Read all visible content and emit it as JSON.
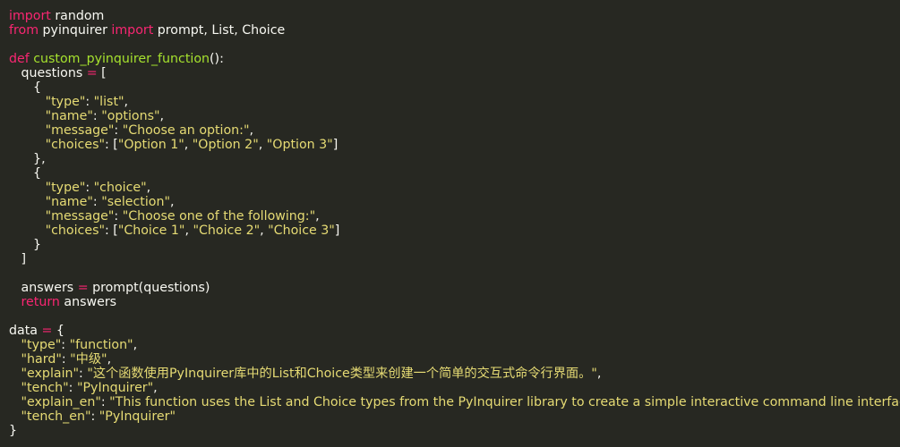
{
  "colors": {
    "background": "#272822",
    "default": "#f8f8f2",
    "keyword": "#f92672",
    "function": "#a6e22e",
    "string": "#e6db74"
  },
  "code": {
    "lines": [
      [
        {
          "t": "import",
          "c": "kw"
        },
        {
          "t": " random",
          "c": "pl"
        }
      ],
      [
        {
          "t": "from",
          "c": "kw"
        },
        {
          "t": " pyinquirer ",
          "c": "pl"
        },
        {
          "t": "import",
          "c": "kw"
        },
        {
          "t": " prompt, List, Choice",
          "c": "pl"
        }
      ],
      [],
      [
        {
          "t": "def",
          "c": "kw"
        },
        {
          "t": " ",
          "c": "pl"
        },
        {
          "t": "custom_pyinquirer_function",
          "c": "fn"
        },
        {
          "t": "():",
          "c": "pl"
        }
      ],
      [
        {
          "t": "   questions ",
          "c": "pl"
        },
        {
          "t": "=",
          "c": "op"
        },
        {
          "t": " [",
          "c": "pl"
        }
      ],
      [
        {
          "t": "      {",
          "c": "pl"
        }
      ],
      [
        {
          "t": "         ",
          "c": "pl"
        },
        {
          "t": "\"type\"",
          "c": "st"
        },
        {
          "t": ": ",
          "c": "pl"
        },
        {
          "t": "\"list\"",
          "c": "st"
        },
        {
          "t": ",",
          "c": "pl"
        }
      ],
      [
        {
          "t": "         ",
          "c": "pl"
        },
        {
          "t": "\"name\"",
          "c": "st"
        },
        {
          "t": ": ",
          "c": "pl"
        },
        {
          "t": "\"options\"",
          "c": "st"
        },
        {
          "t": ",",
          "c": "pl"
        }
      ],
      [
        {
          "t": "         ",
          "c": "pl"
        },
        {
          "t": "\"message\"",
          "c": "st"
        },
        {
          "t": ": ",
          "c": "pl"
        },
        {
          "t": "\"Choose an option:\"",
          "c": "st"
        },
        {
          "t": ",",
          "c": "pl"
        }
      ],
      [
        {
          "t": "         ",
          "c": "pl"
        },
        {
          "t": "\"choices\"",
          "c": "st"
        },
        {
          "t": ": [",
          "c": "pl"
        },
        {
          "t": "\"Option 1\"",
          "c": "st"
        },
        {
          "t": ", ",
          "c": "pl"
        },
        {
          "t": "\"Option 2\"",
          "c": "st"
        },
        {
          "t": ", ",
          "c": "pl"
        },
        {
          "t": "\"Option 3\"",
          "c": "st"
        },
        {
          "t": "]",
          "c": "pl"
        }
      ],
      [
        {
          "t": "      },",
          "c": "pl"
        }
      ],
      [
        {
          "t": "      {",
          "c": "pl"
        }
      ],
      [
        {
          "t": "         ",
          "c": "pl"
        },
        {
          "t": "\"type\"",
          "c": "st"
        },
        {
          "t": ": ",
          "c": "pl"
        },
        {
          "t": "\"choice\"",
          "c": "st"
        },
        {
          "t": ",",
          "c": "pl"
        }
      ],
      [
        {
          "t": "         ",
          "c": "pl"
        },
        {
          "t": "\"name\"",
          "c": "st"
        },
        {
          "t": ": ",
          "c": "pl"
        },
        {
          "t": "\"selection\"",
          "c": "st"
        },
        {
          "t": ",",
          "c": "pl"
        }
      ],
      [
        {
          "t": "         ",
          "c": "pl"
        },
        {
          "t": "\"message\"",
          "c": "st"
        },
        {
          "t": ": ",
          "c": "pl"
        },
        {
          "t": "\"Choose one of the following:\"",
          "c": "st"
        },
        {
          "t": ",",
          "c": "pl"
        }
      ],
      [
        {
          "t": "         ",
          "c": "pl"
        },
        {
          "t": "\"choices\"",
          "c": "st"
        },
        {
          "t": ": [",
          "c": "pl"
        },
        {
          "t": "\"Choice 1\"",
          "c": "st"
        },
        {
          "t": ", ",
          "c": "pl"
        },
        {
          "t": "\"Choice 2\"",
          "c": "st"
        },
        {
          "t": ", ",
          "c": "pl"
        },
        {
          "t": "\"Choice 3\"",
          "c": "st"
        },
        {
          "t": "]",
          "c": "pl"
        }
      ],
      [
        {
          "t": "      }",
          "c": "pl"
        }
      ],
      [
        {
          "t": "   ]",
          "c": "pl"
        }
      ],
      [],
      [
        {
          "t": "   answers ",
          "c": "pl"
        },
        {
          "t": "=",
          "c": "op"
        },
        {
          "t": " prompt(questions)",
          "c": "pl"
        }
      ],
      [
        {
          "t": "   ",
          "c": "pl"
        },
        {
          "t": "return",
          "c": "kw"
        },
        {
          "t": " answers",
          "c": "pl"
        }
      ],
      [],
      [
        {
          "t": "data ",
          "c": "pl"
        },
        {
          "t": "=",
          "c": "op"
        },
        {
          "t": " {",
          "c": "pl"
        }
      ],
      [
        {
          "t": "   ",
          "c": "pl"
        },
        {
          "t": "\"type\"",
          "c": "st"
        },
        {
          "t": ": ",
          "c": "pl"
        },
        {
          "t": "\"function\"",
          "c": "st"
        },
        {
          "t": ",",
          "c": "pl"
        }
      ],
      [
        {
          "t": "   ",
          "c": "pl"
        },
        {
          "t": "\"hard\"",
          "c": "st"
        },
        {
          "t": ": ",
          "c": "pl"
        },
        {
          "t": "\"中级\"",
          "c": "st"
        },
        {
          "t": ",",
          "c": "pl"
        }
      ],
      [
        {
          "t": "   ",
          "c": "pl"
        },
        {
          "t": "\"explain\"",
          "c": "st"
        },
        {
          "t": ": ",
          "c": "pl"
        },
        {
          "t": "\"这个函数使用PyInquirer库中的List和Choice类型来创建一个简单的交互式命令行界面。\"",
          "c": "st"
        },
        {
          "t": ",",
          "c": "pl"
        }
      ],
      [
        {
          "t": "   ",
          "c": "pl"
        },
        {
          "t": "\"tench\"",
          "c": "st"
        },
        {
          "t": ": ",
          "c": "pl"
        },
        {
          "t": "\"PyInquirer\"",
          "c": "st"
        },
        {
          "t": ",",
          "c": "pl"
        }
      ],
      [
        {
          "t": "   ",
          "c": "pl"
        },
        {
          "t": "\"explain_en\"",
          "c": "st"
        },
        {
          "t": ": ",
          "c": "pl"
        },
        {
          "t": "\"This function uses the List and Choice types from the PyInquirer library to create a simple interactive command line interface.\"",
          "c": "st"
        },
        {
          "t": ",",
          "c": "pl"
        }
      ],
      [
        {
          "t": "   ",
          "c": "pl"
        },
        {
          "t": "\"tench_en\"",
          "c": "st"
        },
        {
          "t": ": ",
          "c": "pl"
        },
        {
          "t": "\"PyInquirer\"",
          "c": "st"
        }
      ],
      [
        {
          "t": "}",
          "c": "pl"
        }
      ]
    ]
  }
}
